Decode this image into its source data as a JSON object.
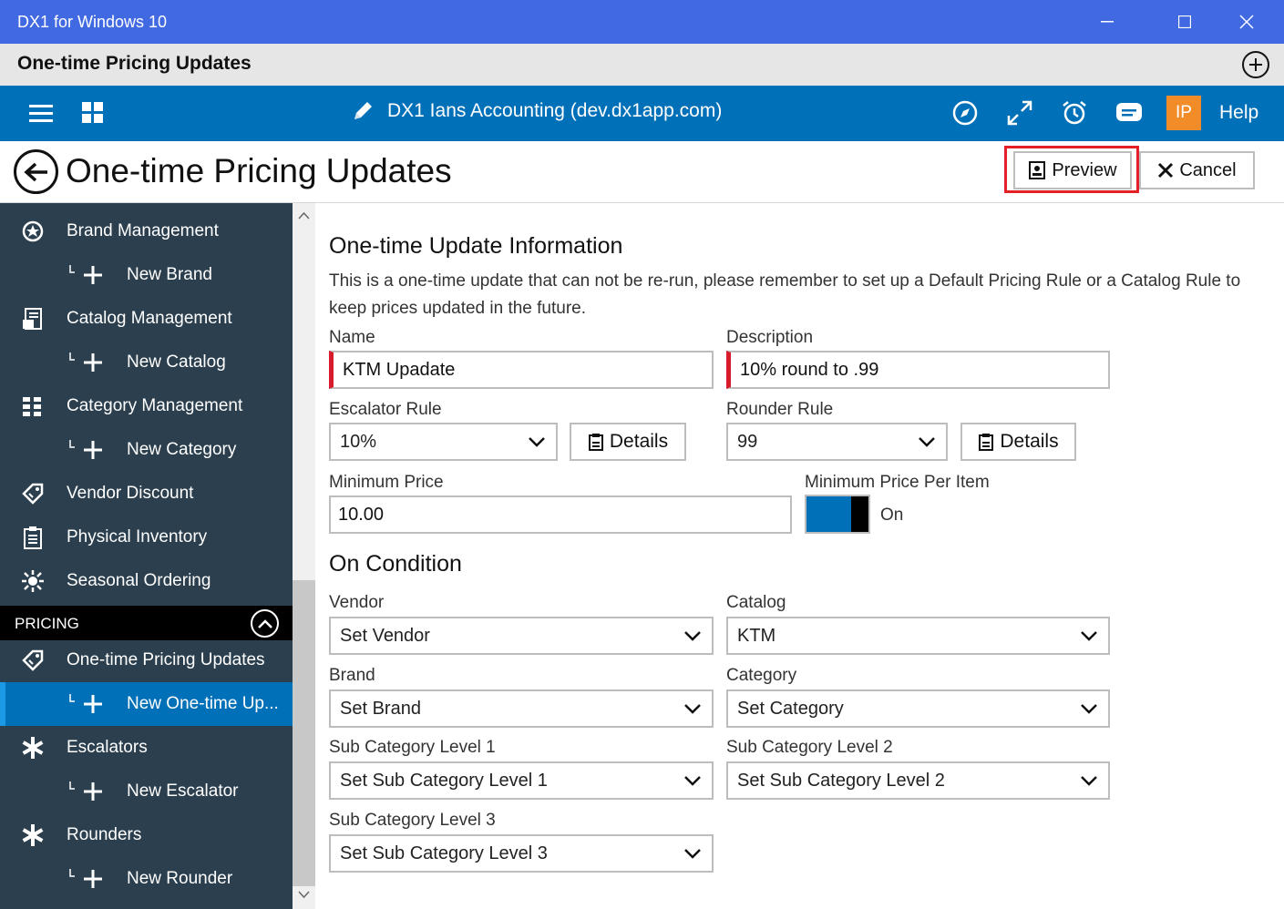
{
  "window": {
    "title": "DX1 for Windows 10"
  },
  "appbar": {
    "title": "One-time Pricing Updates"
  },
  "navbar": {
    "company": "DX1 Ians Accounting (dev.dx1app.com)",
    "avatar": "IP",
    "help": "Help"
  },
  "page": {
    "title": "One-time Pricing Updates",
    "preview": "Preview",
    "cancel": "Cancel"
  },
  "sidebar": {
    "items": [
      {
        "label": "Brand Management",
        "icon": "brand-icon"
      },
      {
        "label": "New Brand",
        "icon": "add-icon"
      },
      {
        "label": "Catalog Management",
        "icon": "catalog-icon"
      },
      {
        "label": "New Catalog",
        "icon": "add-icon"
      },
      {
        "label": "Category Management",
        "icon": "category-icon"
      },
      {
        "label": "New Category",
        "icon": "add-icon"
      },
      {
        "label": "Vendor Discount",
        "icon": "tag-icon"
      },
      {
        "label": "Physical Inventory",
        "icon": "clipboard-icon"
      },
      {
        "label": "Seasonal Ordering",
        "icon": "sun-icon"
      }
    ],
    "section": "PRICING",
    "pricing_items": [
      {
        "label": "One-time Pricing Updates",
        "icon": "tag-icon"
      },
      {
        "label": "New One-time Up...",
        "icon": "add-icon"
      },
      {
        "label": "Escalators",
        "icon": "asterisk-icon"
      },
      {
        "label": "New Escalator",
        "icon": "add-icon"
      },
      {
        "label": "Rounders",
        "icon": "asterisk-icon"
      },
      {
        "label": "New Rounder",
        "icon": "add-icon"
      }
    ]
  },
  "form": {
    "section1": "One-time Update Information",
    "description": "This is a one-time update that can not be re-run, please remember to set up a Default Pricing Rule or a Catalog Rule to keep prices updated in the future.",
    "name_label": "Name",
    "name_value": "KTM Upadate",
    "desc_label": "Description",
    "desc_value": "10% round to .99",
    "escalator_label": "Escalator Rule",
    "escalator_value": "10%",
    "rounder_label": "Rounder Rule",
    "rounder_value": "99",
    "details_label": "Details",
    "minprice_label": "Minimum Price",
    "minprice_value": "10.00",
    "minper_label": "Minimum Price Per Item",
    "minper_state": "On",
    "section2": "On Condition",
    "vendor_label": "Vendor",
    "vendor_value": "Set Vendor",
    "catalog_label": "Catalog",
    "catalog_value": "KTM",
    "brand_label": "Brand",
    "brand_value": "Set Brand",
    "category_label": "Category",
    "category_value": "Set Category",
    "sub1_label": "Sub Category Level 1",
    "sub1_value": "Set Sub Category Level 1",
    "sub2_label": "Sub Category Level 2",
    "sub2_value": "Set Sub Category Level 2",
    "sub3_label": "Sub Category Level 3",
    "sub3_value": "Set Sub Category Level 3"
  }
}
